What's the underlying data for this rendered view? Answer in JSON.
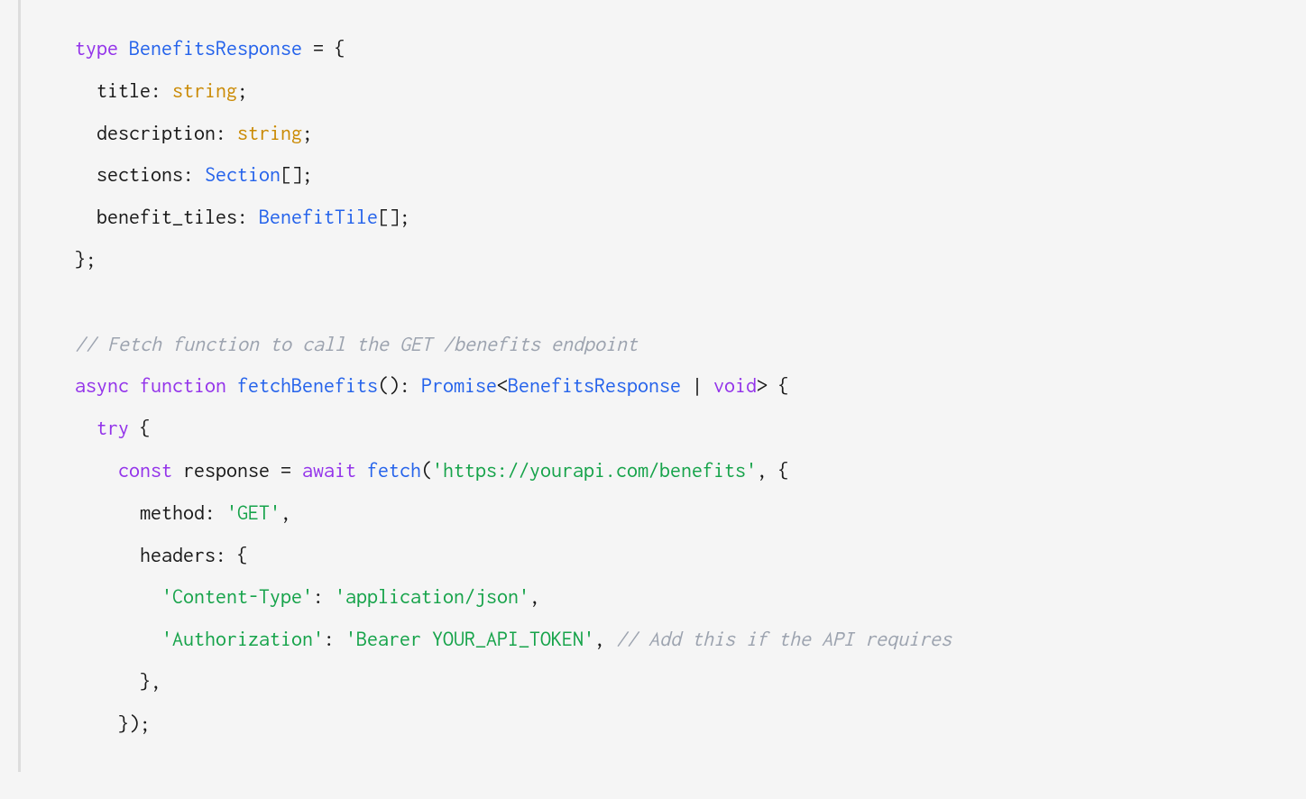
{
  "code": {
    "line1": {
      "keyword_type": "type",
      "type_name": "BenefitsResponse",
      "equals": " = {"
    },
    "line2": {
      "property": "  title",
      "colon": ": ",
      "type": "string",
      "semi": ";"
    },
    "line3": {
      "property": "  description",
      "colon": ": ",
      "type": "string",
      "semi": ";"
    },
    "line4": {
      "property": "  sections",
      "colon": ": ",
      "type": "Section",
      "brackets": "[];"
    },
    "line5": {
      "property": "  benefit_tiles",
      "colon": ": ",
      "type": "BenefitTile",
      "brackets": "[];"
    },
    "line6": {
      "text": "};"
    },
    "line7_blank": "",
    "line8": {
      "comment": "// Fetch function to call the GET /benefits endpoint"
    },
    "line9": {
      "async": "async",
      "function": "function",
      "name": "fetchBenefits",
      "parens": "()",
      "colon": ": ",
      "promise": "Promise",
      "lt": "<",
      "resp_type": "BenefitsResponse",
      "pipe": " | ",
      "void": "void",
      "gt": "> {"
    },
    "line10": {
      "try": "  try",
      "brace": " {"
    },
    "line11": {
      "const": "    const",
      "var": " response ",
      "equals": "= ",
      "await": "await",
      "fetch": " fetch",
      "paren": "(",
      "url": "'https://yourapi.com/benefits'",
      "comma": ", {"
    },
    "line12": {
      "property": "      method",
      "colon": ": ",
      "value": "'GET'",
      "comma": ","
    },
    "line13": {
      "property": "      headers",
      "colon": ": {"
    },
    "line14": {
      "key": "        'Content-Type'",
      "colon": ": ",
      "value": "'application/json'",
      "comma": ","
    },
    "line15": {
      "key": "        'Authorization'",
      "colon": ": ",
      "value": "'Bearer YOUR_API_TOKEN'",
      "comma": ", ",
      "comment": "// Add this if the API requires"
    },
    "line16": {
      "text": "      },"
    },
    "line17": {
      "text": "    });"
    }
  }
}
